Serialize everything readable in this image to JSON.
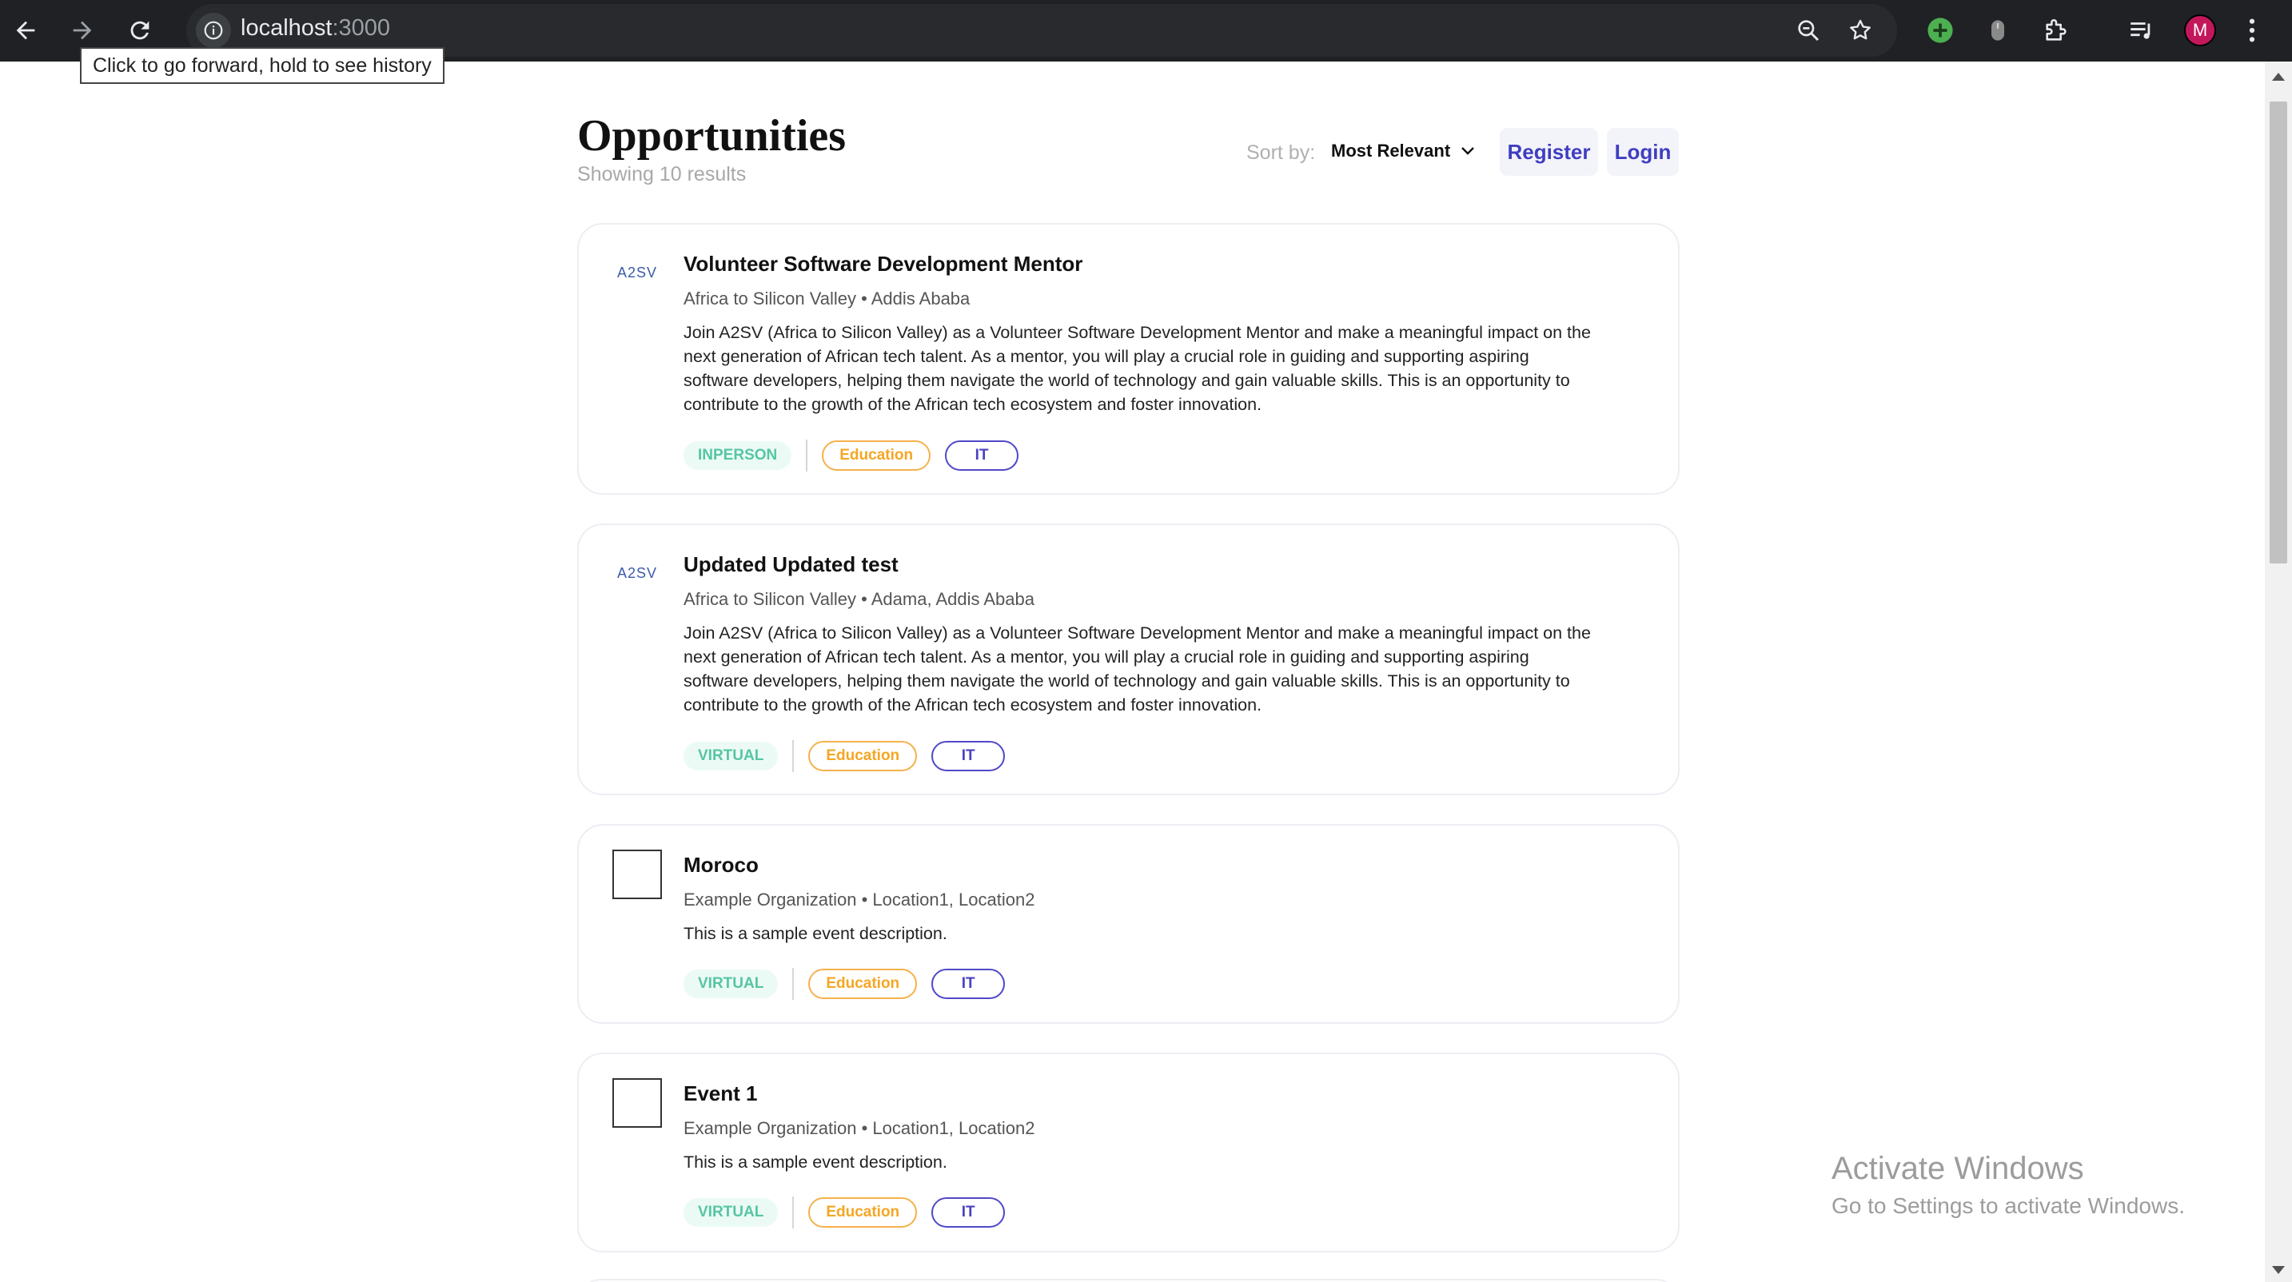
{
  "browser": {
    "url_host": "localhost",
    "url_port": ":3000",
    "avatar_letter": "M",
    "tooltip": "Click to go forward, hold to see history"
  },
  "page": {
    "title": "Opportunities",
    "results": "Showing 10 results",
    "sort_label": "Sort by:",
    "sort_value": "Most Relevant",
    "register_label": "Register",
    "login_label": "Login"
  },
  "cards": [
    {
      "logo": "A2SV",
      "title": "Volunteer Software Development Mentor",
      "org": "Africa to Silicon Valley",
      "location": "Addis Ababa",
      "description": "Join A2SV (Africa to Silicon Valley) as a Volunteer Software Development Mentor and make a meaningful impact on the next generation of African tech talent. As a mentor, you will play a crucial role in guiding and supporting aspiring software developers, helping them navigate the world of technology and gain valuable skills. This is an opportunity to contribute to the growth of the African tech ecosystem and foster innovation.",
      "mode": "INPERSON",
      "category": "Education",
      "tag": "IT"
    },
    {
      "logo": "A2SV",
      "title": "Updated Updated test",
      "org": "Africa to Silicon Valley",
      "location": "Adama, Addis Ababa",
      "description": "Join A2SV (Africa to Silicon Valley) as a Volunteer Software Development Mentor and make a meaningful impact on the next generation of African tech talent. As a mentor, you will play a crucial role in guiding and supporting aspiring software developers, helping them navigate the world of technology and gain valuable skills. This is an opportunity to contribute to the growth of the African tech ecosystem and foster innovation.",
      "mode": "VIRTUAL",
      "category": "Education",
      "tag": "IT"
    },
    {
      "logo": "",
      "title": "Moroco",
      "org": "Example Organization",
      "location": "Location1, Location2",
      "description": "This is a sample event description.",
      "mode": "VIRTUAL",
      "category": "Education",
      "tag": "IT"
    },
    {
      "logo": "",
      "title": "Event 1",
      "org": "Example Organization",
      "location": "Location1, Location2",
      "description": "This is a sample event description.",
      "mode": "VIRTUAL",
      "category": "Education",
      "tag": "IT"
    }
  ],
  "watermark": {
    "title": "Activate Windows",
    "subtitle": "Go to Settings to activate Windows."
  },
  "colors": {
    "accent": "#3f3ec0",
    "mode_tag": "#56c6a2",
    "category_tag": "#f5a623"
  }
}
